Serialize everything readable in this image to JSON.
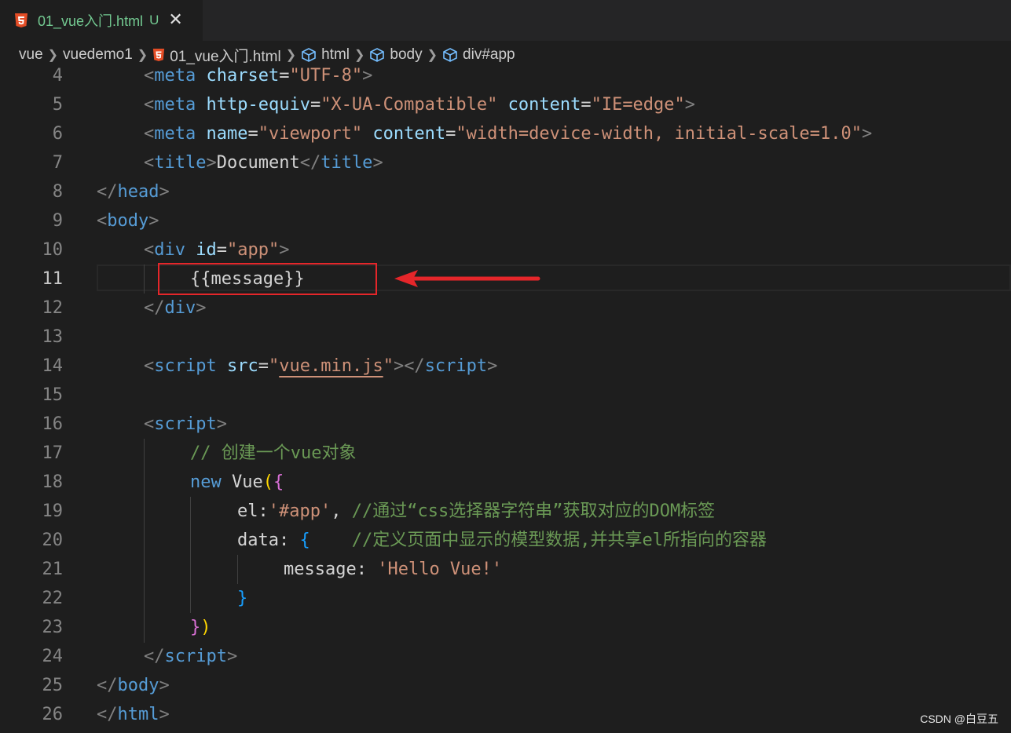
{
  "tab": {
    "title": "01_vue入门.html",
    "status": "U",
    "close": "✕"
  },
  "breadcrumb": [
    "vue",
    "vuedemo1",
    "01_vue入门.html",
    "html",
    "body",
    "div#app"
  ],
  "line_numbers": [
    "4",
    "5",
    "6",
    "7",
    "8",
    "9",
    "10",
    "11",
    "12",
    "13",
    "14",
    "15",
    "16",
    "17",
    "18",
    "19",
    "20",
    "21",
    "22",
    "23",
    "24",
    "25",
    "26"
  ],
  "active_line": "11",
  "code": {
    "l4": [
      "<",
      "meta",
      " ",
      "charset",
      "=",
      "\"UTF-8\"",
      ">"
    ],
    "l5": [
      "<",
      "meta",
      " ",
      "http-equiv",
      "=",
      "\"X-UA-Compatible\"",
      " ",
      "content",
      "=",
      "\"IE=edge\"",
      ">"
    ],
    "l6": [
      "<",
      "meta",
      " ",
      "name",
      "=",
      "\"viewport\"",
      " ",
      "content",
      "=",
      "\"width=device-width, initial-scale=1.0\"",
      ">"
    ],
    "l7": [
      "<",
      "title",
      ">",
      "Document",
      "</",
      "title",
      ">"
    ],
    "l8": [
      "</",
      "head",
      ">"
    ],
    "l9": [
      "<",
      "body",
      ">"
    ],
    "l10": [
      "<",
      "div",
      " ",
      "id",
      "=",
      "\"app\"",
      ">"
    ],
    "l11": [
      "{{message}}"
    ],
    "l12": [
      "</",
      "div",
      ">"
    ],
    "l14": [
      "<",
      "script",
      " ",
      "src",
      "=",
      "\"",
      "vue.min.js",
      "\"",
      ">",
      "</",
      "script",
      ">"
    ],
    "l16": [
      "<",
      "script",
      ">"
    ],
    "l17": [
      "// 创建一个vue对象"
    ],
    "l18": [
      "new",
      " ",
      "Vue",
      "(",
      "{"
    ],
    "l19": [
      "el",
      ":",
      "'#app'",
      ", ",
      "//通过“css选择器字符串”获取对应的DOM标签"
    ],
    "l20": [
      "data",
      ": ",
      "{",
      "    ",
      "//定义页面中显示的模型数据,并共享el所指向的容器"
    ],
    "l21": [
      "message",
      ": ",
      "'Hello Vue!'"
    ],
    "l22": [
      "}"
    ],
    "l23": [
      "}",
      ")"
    ],
    "l24": [
      "</",
      "script",
      ">"
    ],
    "l25": [
      "</",
      "body",
      ">"
    ],
    "l26": [
      "</",
      "html",
      ">"
    ]
  },
  "watermark": "CSDN @白豆五",
  "colors": {
    "annotation": "#e5262a",
    "tag": "#569cd6",
    "attribute": "#9cdcfe",
    "string": "#ce9178",
    "comment": "#6a9955"
  }
}
